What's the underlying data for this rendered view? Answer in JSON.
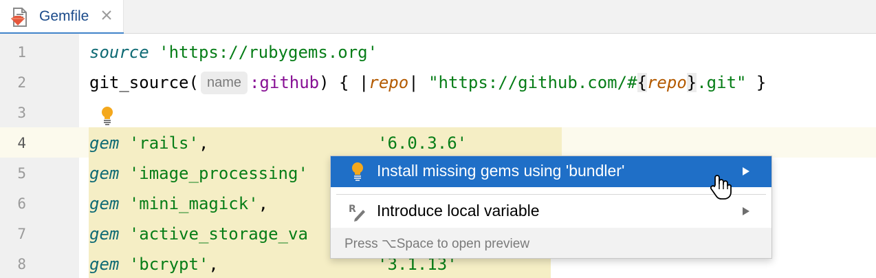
{
  "tab": {
    "title": "Gemfile",
    "icon": "gemfile-icon",
    "close_icon": "close-icon"
  },
  "editor": {
    "lines": [
      {
        "number": "1",
        "tokens": [
          {
            "text": "source",
            "style": "kw-i"
          },
          {
            "text": " ",
            "style": ""
          },
          {
            "text": "'https://rubygems.org'",
            "style": "str"
          }
        ]
      },
      {
        "number": "2",
        "tokens": [
          {
            "text": "git_source(",
            "style": ""
          },
          {
            "text": "name",
            "style": "param-hint"
          },
          {
            "text": ":github",
            "style": "sym"
          },
          {
            "text": ") { |",
            "style": ""
          },
          {
            "text": "repo",
            "style": "var-i"
          },
          {
            "text": "| ",
            "style": ""
          },
          {
            "text": "\"https://github.com/#",
            "style": "str"
          },
          {
            "text": "{",
            "style": "brace-hl"
          },
          {
            "text": "repo",
            "style": "var-i"
          },
          {
            "text": "}",
            "style": "brace-hl"
          },
          {
            "text": ".git\"",
            "style": "str"
          },
          {
            "text": " }",
            "style": ""
          }
        ]
      },
      {
        "number": "3",
        "tokens": []
      },
      {
        "number": "4",
        "tokens": [
          {
            "text": "gem",
            "style": "kw-i"
          },
          {
            "text": " ",
            "style": ""
          },
          {
            "text": "'rails'",
            "style": "str"
          },
          {
            "text": ",                 ",
            "style": ""
          },
          {
            "text": "'6.0.3.6'",
            "style": "str"
          }
        ]
      },
      {
        "number": "5",
        "tokens": [
          {
            "text": "gem",
            "style": "kw-i"
          },
          {
            "text": " ",
            "style": ""
          },
          {
            "text": "'image_processing'",
            "style": "str"
          }
        ]
      },
      {
        "number": "6",
        "tokens": [
          {
            "text": "gem",
            "style": "kw-i"
          },
          {
            "text": " ",
            "style": ""
          },
          {
            "text": "'mini_magick'",
            "style": "str"
          },
          {
            "text": ",",
            "style": ""
          }
        ]
      },
      {
        "number": "7",
        "tokens": [
          {
            "text": "gem",
            "style": "kw-i"
          },
          {
            "text": " ",
            "style": ""
          },
          {
            "text": "'active_storage_va",
            "style": "str"
          }
        ]
      },
      {
        "number": "8",
        "tokens": [
          {
            "text": "gem",
            "style": "kw-i"
          },
          {
            "text": " ",
            "style": ""
          },
          {
            "text": "'bcrypt'",
            "style": "str"
          },
          {
            "text": ",                ",
            "style": ""
          },
          {
            "text": "'3.1.13'",
            "style": "str"
          }
        ]
      }
    ],
    "current_line": "4",
    "gutter_bulb_icon": "lightbulb-icon"
  },
  "popup": {
    "items": [
      {
        "label": "Install missing gems using 'bundler'",
        "icon": "lightbulb-icon",
        "selected": true
      },
      {
        "label": "Introduce local variable",
        "icon": "refactor-icon",
        "selected": false
      }
    ],
    "footer": "Press ⌥Space to open preview"
  },
  "colors": {
    "selection": "#1f6fc7",
    "string": "#067d17",
    "keyword": "#0e6a74",
    "symbol": "#871094",
    "variable": "#b35a00",
    "warning_background": "#f5eec5"
  }
}
